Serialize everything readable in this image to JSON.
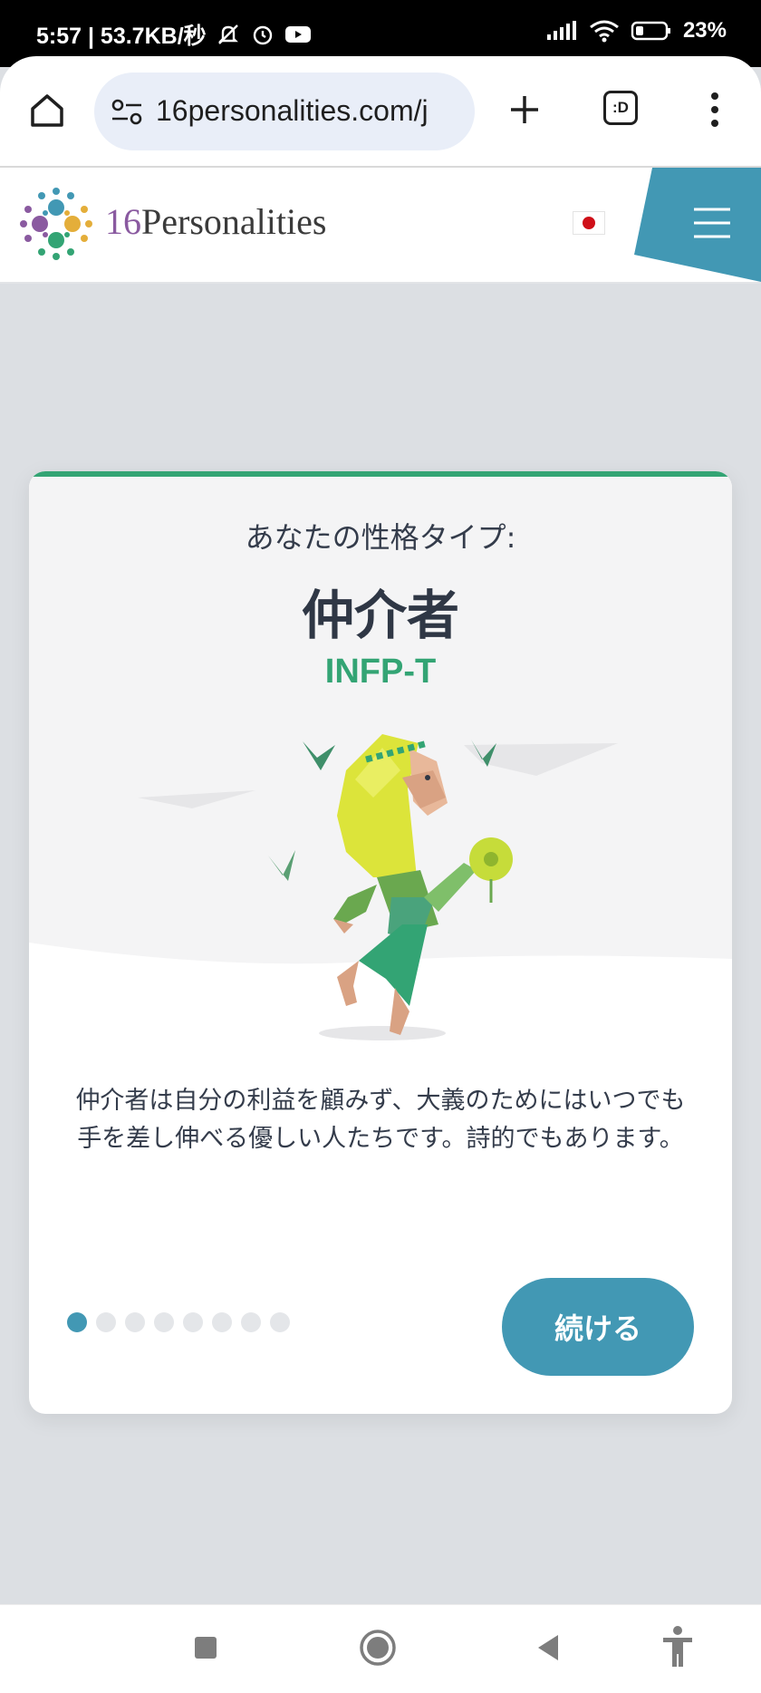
{
  "status_bar": {
    "time_speed": "5:57 | 53.7KB/秒",
    "battery": "23%"
  },
  "browser": {
    "url": "16personalities.com/j",
    "tabs_label": ":D"
  },
  "site": {
    "brand_number": "16",
    "brand_name": "Personalities",
    "flag": "japan-flag"
  },
  "result": {
    "subtitle": "あなたの性格タイプ:",
    "type_name": "仲介者",
    "type_code": "INFP-T",
    "description": "仲介者は自分の利益を顧みず、大義のためにはいつでも手を差し伸べる優しい人たちです。詩的でもあります。",
    "continue_label": "続ける",
    "progress": {
      "current": 1,
      "total": 8
    }
  },
  "colors": {
    "accent_blue": "#4298b4",
    "accent_green": "#33a474",
    "text_dark": "#343c4b"
  }
}
